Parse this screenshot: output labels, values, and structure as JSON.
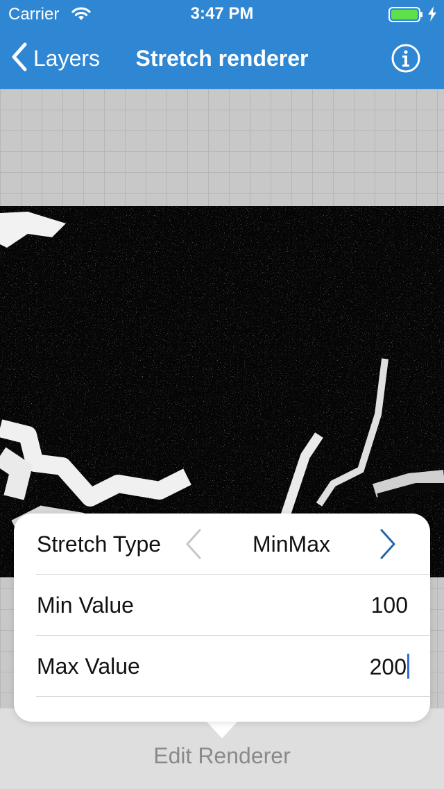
{
  "status_bar": {
    "carrier": "Carrier",
    "time": "3:47 PM"
  },
  "nav": {
    "back_label": "Layers",
    "title": "Stretch renderer",
    "info_icon": "info-icon",
    "accent": "#2f86d3"
  },
  "popover": {
    "stretch_type": {
      "label": "Stretch Type",
      "value": "MinMax"
    },
    "min_value": {
      "label": "Min Value",
      "value": "100"
    },
    "max_value": {
      "label": "Max Value",
      "value": "200"
    }
  },
  "toolbar": {
    "edit_renderer_label": "Edit Renderer"
  }
}
